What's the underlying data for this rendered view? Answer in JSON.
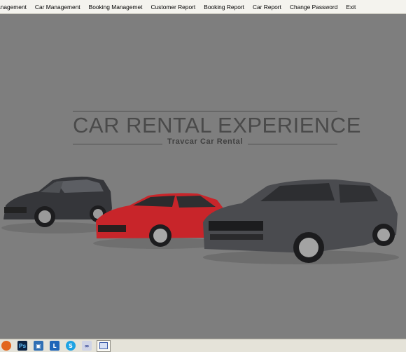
{
  "menu": {
    "items": [
      {
        "label": "anagement"
      },
      {
        "label": "Car Management"
      },
      {
        "label": "Booking Managemet"
      },
      {
        "label": "Customer Report"
      },
      {
        "label": "Booking Report"
      },
      {
        "label": "Car Report"
      },
      {
        "label": "Change Password"
      },
      {
        "label": "Exit"
      }
    ]
  },
  "banner": {
    "title": "CAR RENTAL EXPERIENCE",
    "subtitle": "Travcar Car Rental"
  },
  "cars": [
    {
      "name": "suv-car",
      "color": "#35363a"
    },
    {
      "name": "sedan-car-red",
      "color": "#c8252a"
    },
    {
      "name": "muscle-car-gray",
      "color": "#4a4b4f"
    }
  ],
  "taskbar": {
    "icons": [
      "firefox-icon",
      "photoshop-icon",
      "app-icon",
      "lync-icon",
      "skype-icon",
      "link-icon",
      "window-icon"
    ]
  },
  "colors": {
    "background": "#7e7e7e",
    "menubar": "#f4f3ee",
    "taskbar": "#e5e3d9"
  }
}
